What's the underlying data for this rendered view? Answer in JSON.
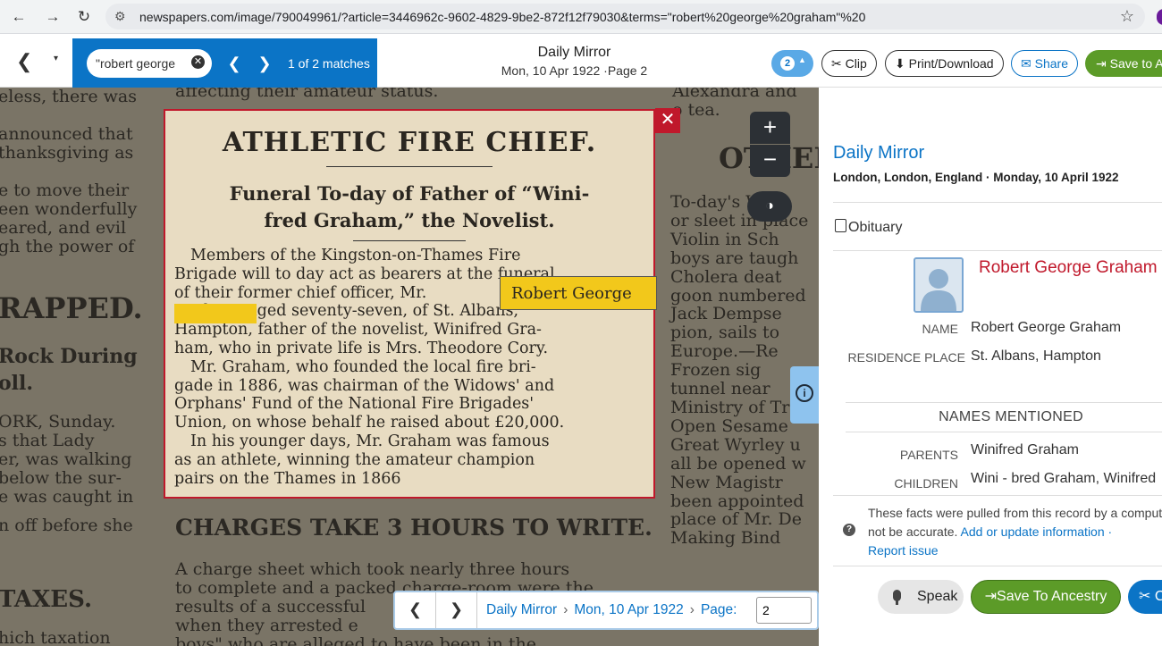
{
  "browser": {
    "url": "newspapers.com/image/790049961/?article=3446962c-9602-4829-9be2-872f12f79030&terms=\"robert%20george%20graham\"%20",
    "back_icon": "←",
    "forward_icon": "→",
    "reload_icon": "↻",
    "star_icon": "☆"
  },
  "toolbar": {
    "back_icon": "❮",
    "caret_icon": "▾",
    "search_value": "\"robert george",
    "clear_icon": "✕",
    "prev_icon": "❮",
    "next_icon": "❯",
    "match_count": "1 of 2 matches",
    "paper_title": "Daily Mirror",
    "paper_date": "Mon, 10 Apr 1922 ·Page 2",
    "notif_count": "2",
    "notif_caret": "▲",
    "clip_label": "Clip",
    "clip_icon": "✂",
    "print_label": "Print/Download",
    "print_icon": "⬇",
    "share_label": "Share",
    "share_icon": "✉",
    "save_label": "Save to A",
    "save_icon": "⇥"
  },
  "clip": {
    "headline": "ATHLETIC FIRE CHIEF.",
    "subhead_line1": "Funeral To-day of Father of “Wini-",
    "subhead_line2": "fred Graham,” the Novelist.",
    "body_lines": [
      "Members of the Kingston-on-Thames Fire",
      "Brigade will to day act as bearers at the funeral",
      "of their former chief officer, Mr.",
      "Graham, aged seventy-seven, of St. Albans,",
      "Hampton, father of the novelist, Winifred Gra-",
      "ham, who in private life is Mrs. Theodore Cory.",
      "Mr. Graham, who founded the local fire bri-",
      "gade in 1886, was chairman of the Widows' and",
      "Orphans' Fund of the National Fire Brigades'",
      "Union, on whose behalf he raised about £20,000.",
      "In his younger days, Mr. Graham was famous",
      "as an athlete, winning the amateur champion",
      "pairs on the Thames in 1866"
    ],
    "highlight_text": "Robert George",
    "close_icon": "✕"
  },
  "viewer_controls": {
    "zoom_in": "+",
    "zoom_out": "−",
    "contrast_icon": "◑",
    "info_icon": "i"
  },
  "background_text": {
    "left_lines": [
      "eless, there was",
      "",
      " announced that",
      " thanksgiving as",
      "",
      "e to move their",
      "een wonderfully",
      "eared, and evil",
      "gh the power of"
    ],
    "left_head1": "RAPPED.",
    "left_head2_a": "Rock During",
    "left_head2_b": "oll.",
    "left_lines2": [
      "ORK, Sunday.",
      "s  that  Lady",
      "er, was walking",
      " below the sur-",
      "e was caught in",
      "",
      "n off before she"
    ],
    "left_head3": "TAXES.",
    "left_last": "hich taxation",
    "top_line": "affecting their amateur status.",
    "right_lines": [
      "Alexandra and",
      "o tea."
    ],
    "right_head": "OTHER",
    "right_lines2": [
      "To-day's Wea",
      "or sleet in place",
      "Violin in Sch",
      "boys are taugh",
      "Cholera deat",
      "goon numbered",
      "Jack Dempse",
      "pion,  sails to",
      "Europe.—Re",
      "Frozen sig",
      "tunnel near",
      "Ministry of Tra",
      "Open Sesame",
      "Great Wyrley u",
      "all be opened w",
      "New Magistr",
      "been appointed",
      "place of Mr. De",
      "Making Bind"
    ],
    "bottom_head": "CHARGES TAKE 3 HOURS TO WRITE.",
    "bottom_lines": [
      "A charge sheet which took nearly three hours",
      "to complete and a packed charge-room were the",
      "results of a successful",
      "when they arrested e",
      "boys\" who are alleged to have been in the"
    ]
  },
  "pager": {
    "prev_icon": "❮",
    "next_icon": "❯",
    "crumb_paper": "Daily Mirror",
    "crumb_sep": "›",
    "crumb_date": "Mon, 10 Apr 1922",
    "crumb_page": "Page:",
    "page_value": "2"
  },
  "panel": {
    "title": "Daily Mirror",
    "place_date": "London, London, England · Monday, 10 April 1922",
    "category": "Obituary",
    "person_name": "Robert George Graham",
    "fields": [
      {
        "label": "NAME",
        "value": "Robert George Graham"
      },
      {
        "label": "RESIDENCE PLACE",
        "value": "St. Albans, Hampton"
      }
    ],
    "names_mentioned_heading": "NAMES MENTIONED",
    "relations": [
      {
        "label": "PARENTS",
        "value": "Winifred Graham"
      },
      {
        "label": "CHILDREN",
        "value": "Wini - bred Graham, Winifred"
      }
    ],
    "disclaimer_text": "These facts were pulled from this record by a comput may not be accurate.",
    "disclaimer_link": "Add or update information ·",
    "report_link": "Report issue",
    "help_icon": "?",
    "speak_label": "Speak",
    "ancestry_label": "Save To Ancestry",
    "ancestry_icon": "⇥",
    "extra_icon": "✂",
    "extra_label": "C"
  },
  "colors": {
    "accent_blue": "#0b74c6",
    "clip_red": "#c0182b",
    "highlight_yellow": "#f2c81b",
    "save_green": "#5c9b28"
  }
}
